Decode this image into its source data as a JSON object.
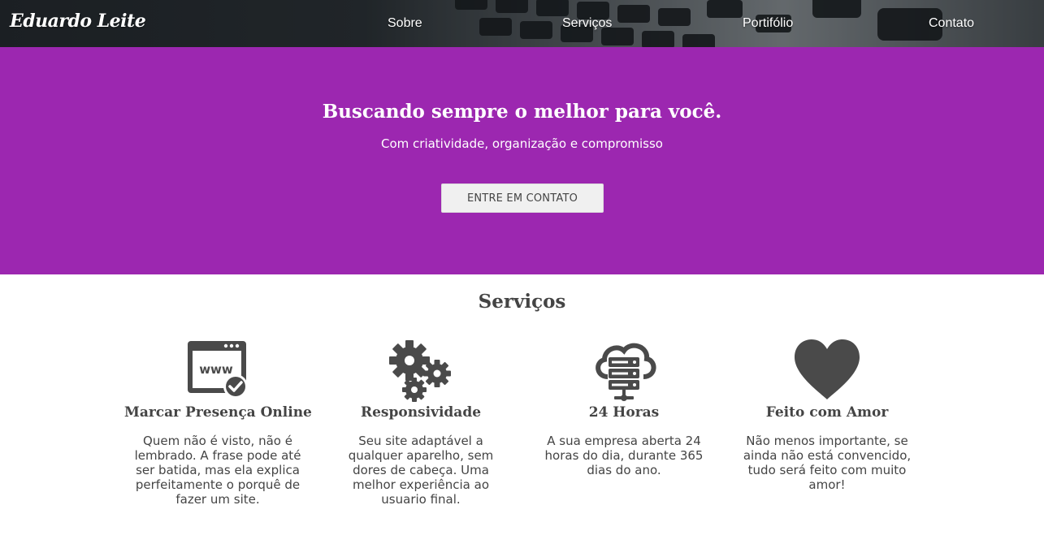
{
  "header": {
    "brand": "Eduardo Leite",
    "nav": {
      "sobre": "Sobre",
      "servicos": "Serviços",
      "portfolio": "Portifólio",
      "contato": "Contato"
    }
  },
  "hero": {
    "title": "Buscando sempre o melhor para você.",
    "subtitle": "Com criatividade, organização e compromisso",
    "button_label": "ENTRE EM CONTATO"
  },
  "services": {
    "title": "Serviços",
    "items": [
      {
        "icon": "website-icon",
        "title": "Marcar Presença Online",
        "text": "Quem não é visto, não é lembrado. A frase pode até ser batida, mas ela explica perfeitamente o porquê de fazer um site."
      },
      {
        "icon": "gears-icon",
        "title": "Responsividade",
        "text": "Seu site adaptável a qualquer aparelho, sem dores de cabeça. Uma melhor experiência ao usuario final."
      },
      {
        "icon": "cloud-server-icon",
        "title": "24 Horas",
        "text": "A sua empresa aberta 24 horas do dia, durante 365 dias do ano."
      },
      {
        "icon": "heart-icon",
        "title": "Feito com Amor",
        "text": "Não menos importante, se ainda não está convencido, tudo será feito com muito amor!"
      }
    ]
  },
  "colors": {
    "hero_background": "#9c27b0",
    "text": "#444444",
    "icon": "#4a4a4a"
  }
}
